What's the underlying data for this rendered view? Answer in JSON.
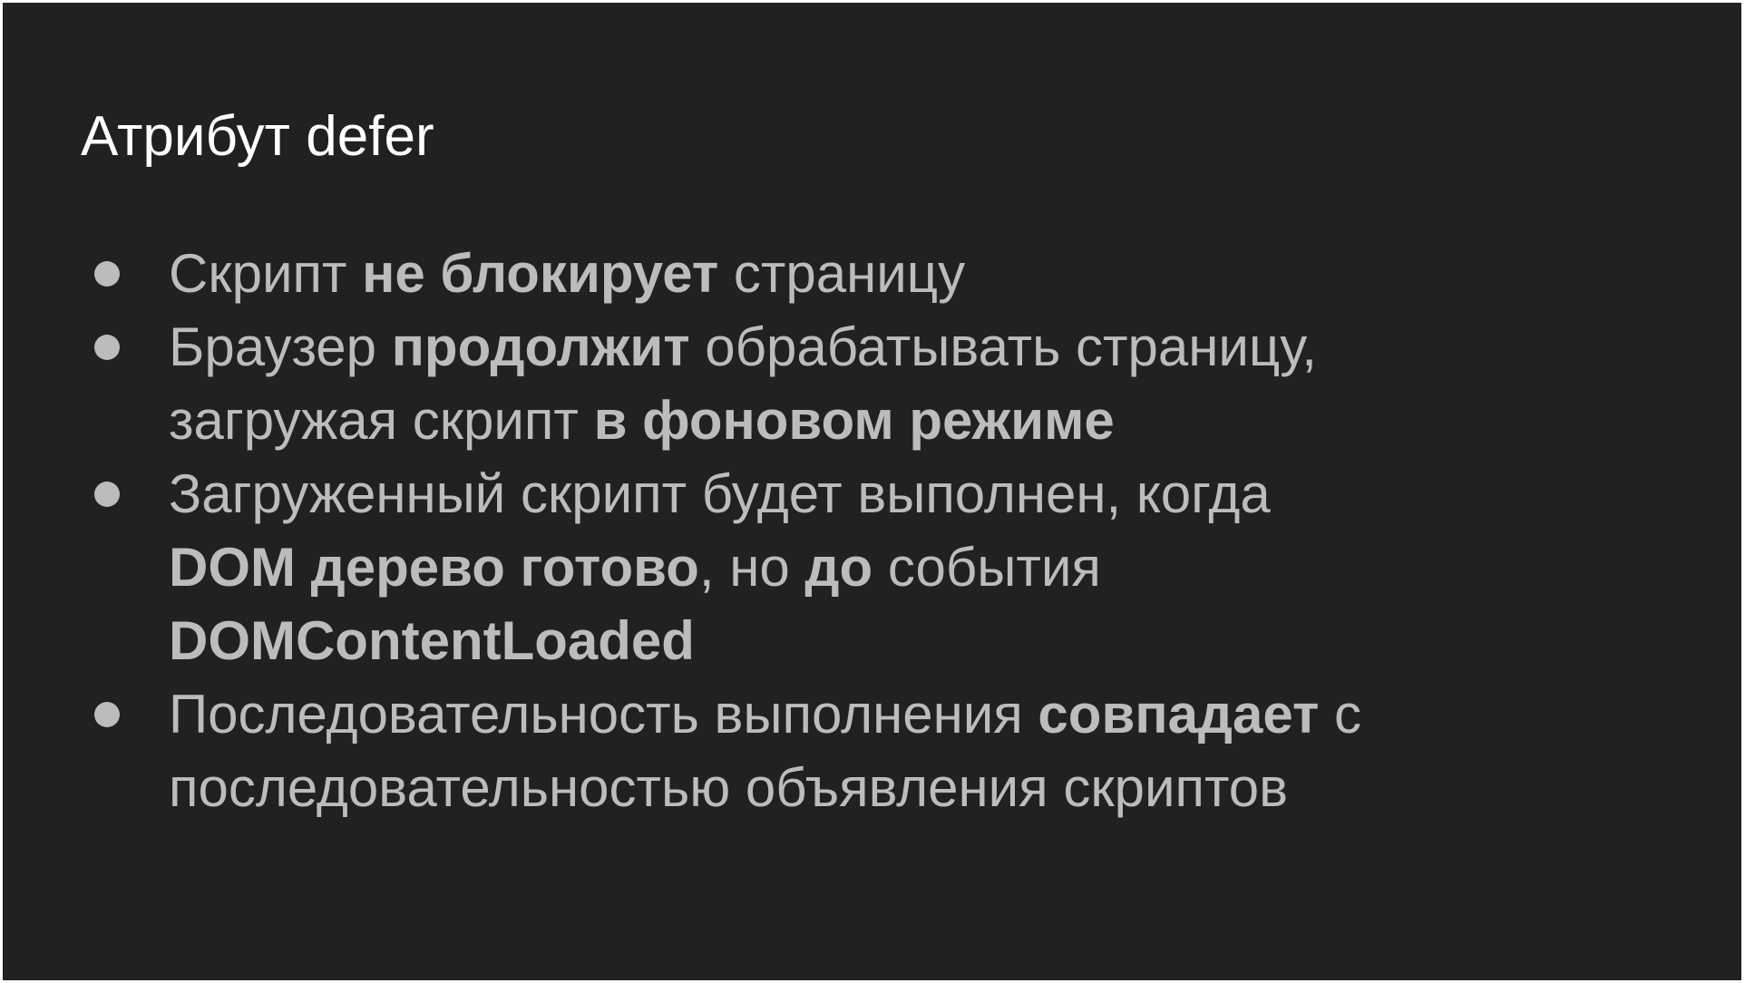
{
  "slide": {
    "title": "Атрибут defer",
    "bullets": [
      {
        "lines": [
          [
            {
              "text": "Скрипт ",
              "bold": false
            },
            {
              "text": "не блокирует",
              "bold": true
            },
            {
              "text": " страницу",
              "bold": false
            }
          ]
        ]
      },
      {
        "lines": [
          [
            {
              "text": "Браузер ",
              "bold": false
            },
            {
              "text": "продолжит",
              "bold": true
            },
            {
              "text": " обрабатывать страницу,",
              "bold": false
            }
          ],
          [
            {
              "text": "загружая скрипт ",
              "bold": false
            },
            {
              "text": "в фоновом режиме",
              "bold": true
            }
          ]
        ]
      },
      {
        "lines": [
          [
            {
              "text": "Загруженный скрипт будет выполнен, когда",
              "bold": false
            }
          ],
          [
            {
              "text": "DOM дерево готово",
              "bold": true
            },
            {
              "text": ", но ",
              "bold": false
            },
            {
              "text": "до",
              "bold": true
            },
            {
              "text": " события",
              "bold": false
            }
          ],
          [
            {
              "text": "DOMContentLoaded",
              "bold": true
            }
          ]
        ]
      },
      {
        "lines": [
          [
            {
              "text": "Последовательность выполнения ",
              "bold": false
            },
            {
              "text": "совпадает",
              "bold": true
            },
            {
              "text": " с",
              "bold": false
            }
          ],
          [
            {
              "text": "последовательностью объявления скриптов",
              "bold": false
            }
          ]
        ]
      }
    ]
  },
  "colors": {
    "background": "#212121",
    "title_text": "#ffffff",
    "body_text": "#bcbcbc",
    "page_border": "#ffffff"
  }
}
